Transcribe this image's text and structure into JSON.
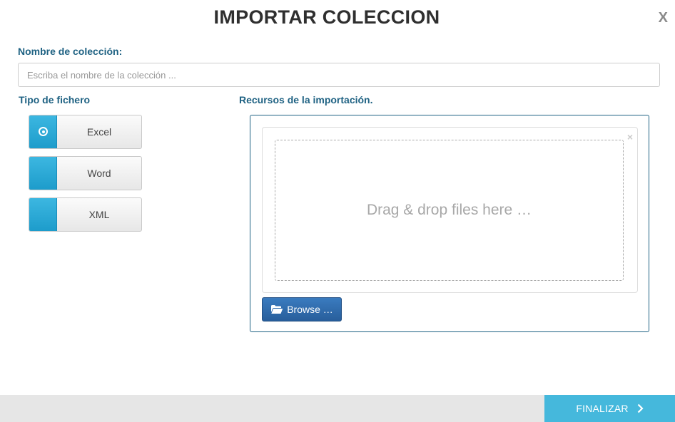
{
  "dialog": {
    "title": "IMPORTAR COLECCION",
    "close_label": "X"
  },
  "collection_name": {
    "label": "Nombre de colección:",
    "value": "",
    "placeholder": "Escriba el nombre de la colección ..."
  },
  "file_type": {
    "label": "Tipo de fichero",
    "selected": "Excel",
    "options": [
      {
        "label": "Excel",
        "selected": true
      },
      {
        "label": "Word",
        "selected": false
      },
      {
        "label": "XML",
        "selected": false
      }
    ]
  },
  "resources": {
    "label": "Recursos de la importación.",
    "drop_text": "Drag & drop files here …",
    "remove_label": "×",
    "browse_label": "Browse …",
    "browse_icon": "folder-open-icon"
  },
  "footer": {
    "finish_label": "FINALIZAR",
    "finish_icon": "chevron-right-icon"
  },
  "colors": {
    "accent": "#1f6283",
    "radio": "#29abdb",
    "browse": "#2f6bab",
    "finish": "#45b8dc",
    "footer_bg": "#e6e6e6"
  }
}
